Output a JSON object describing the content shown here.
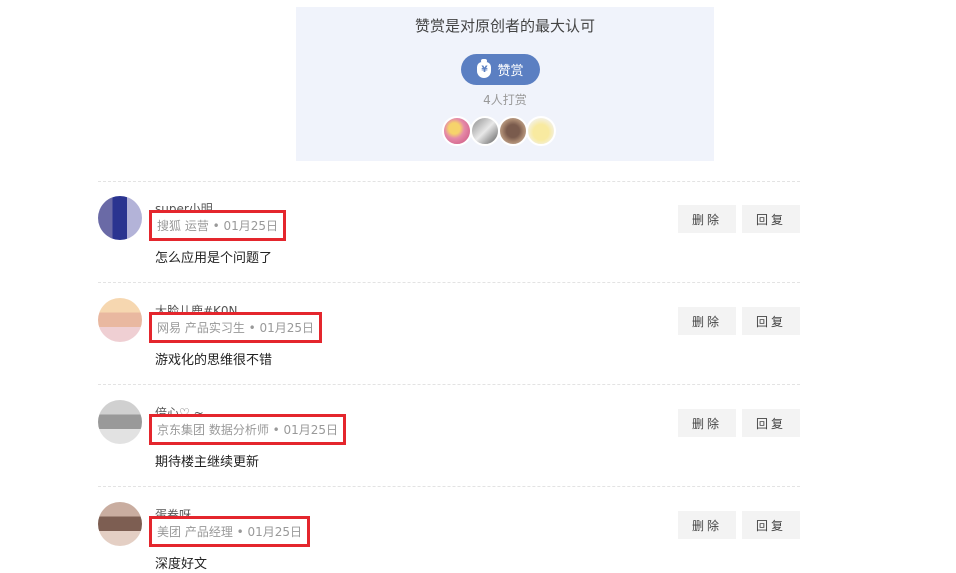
{
  "reward": {
    "title": "赞赏是对原创者的最大认可",
    "button_label": "赞赏",
    "count_text": "4人打赏"
  },
  "comments": [
    {
      "name": "super小明",
      "meta": "搜狐 运营 • 01月25日",
      "text": "怎么应用是个问题了"
    },
    {
      "name": "大脸儿鹿#K0N",
      "meta": "网易 产品实习生 • 01月25日",
      "text": "游戏化的思维很不错"
    },
    {
      "name": "偣心♡ ~",
      "meta": "京东集团 数据分析师 • 01月25日",
      "text": "期待楼主继续更新"
    },
    {
      "name": "蛋卷呀",
      "meta": "美团 产品经理 • 01月25日",
      "text": "深度好文"
    }
  ],
  "actions": {
    "delete_label": "删除",
    "reply_label": "回复"
  },
  "colors": {
    "highlight": "#e4262d",
    "reward_button": "#5b7fc2",
    "reward_bg": "#f0f3fb"
  }
}
